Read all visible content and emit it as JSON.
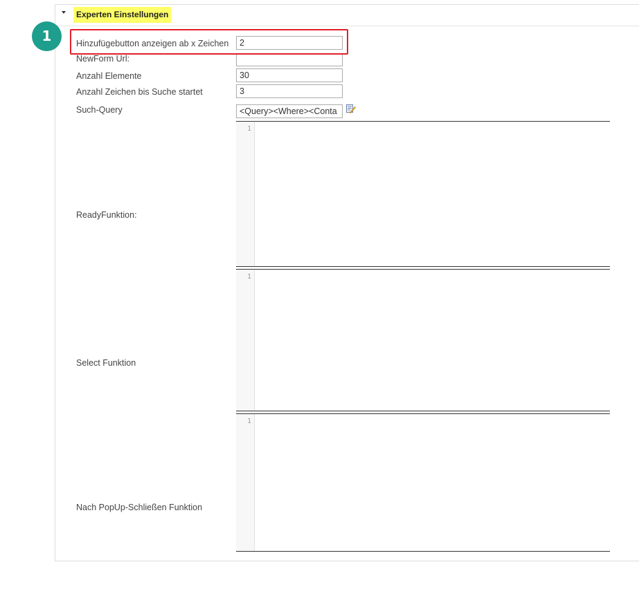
{
  "panel": {
    "title": "Experten Einstellungen",
    "fields": [
      {
        "label": "Hinzufügebutton anzeigen ab x Zeichen",
        "value": "2"
      },
      {
        "label": "NewForm Url:",
        "value": ""
      },
      {
        "label": "Anzahl Elemente",
        "value": "30"
      },
      {
        "label": "Anzahl Zeichen bis Suche startet",
        "value": "3"
      },
      {
        "label": "Such-Query",
        "value": "<Query><Where><Conta"
      }
    ],
    "editors": [
      {
        "label": "ReadyFunktion:",
        "line": "1"
      },
      {
        "label": "Select Funktion",
        "line": "1"
      },
      {
        "label": "Nach PopUp-Schließen Funktion",
        "line": "1"
      }
    ]
  },
  "annotation": {
    "badge": "1",
    "color": "#e0202a",
    "badge_color": "#1e9e8c"
  },
  "icons": {
    "toggle": "triangle-down-icon",
    "edit": "edit-pencil-icon"
  }
}
